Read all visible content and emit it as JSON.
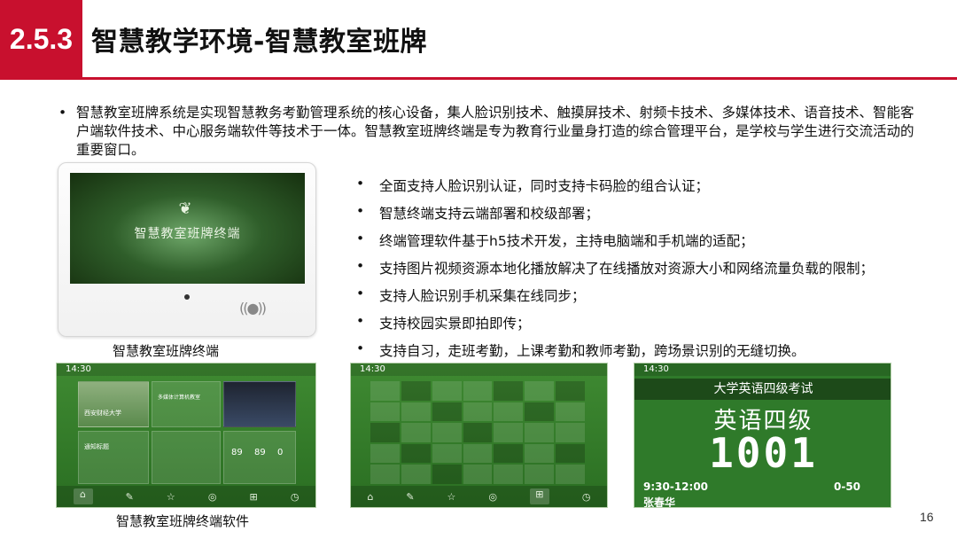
{
  "header": {
    "section_number": "2.5.3",
    "title": "智慧教学环境-智慧教室班牌",
    "accent_color": "#c8102e"
  },
  "intro": {
    "bullet": "•",
    "text": "智慧教室班牌系统是实现智慧教务考勤管理系统的核心设备，集人脸识别技术、触摸屏技术、射频卡技术、多媒体技术、语音技术、智能客户端软件技术、中心服务端软件等技术于一体。智慧教室班牌终端是专为教育行业量身打造的综合管理平台，是学校与学生进行交流活动的重要窗口。"
  },
  "device": {
    "screen_brand": "智慧教室班牌终端",
    "caption": "智慧教室班牌终端",
    "icons": [
      "leaf-icon",
      "nfc-icon"
    ]
  },
  "features": [
    "全面支持人脸识别认证，同时支持卡码脸的组合认证；",
    "智慧终端支持云端部署和校级部署；",
    "终端管理软件基于h5技术开发，主持电脑端和手机端的适配；",
    "支持图片视频资源本地化播放解决了在线播放对资源大小和网络流量负载的限制；",
    "支持人脸识别手机采集在线同步；",
    "支持校园实景即拍即传；",
    "支持自习，走班考勤，上课考勤和教师考勤，跨场景识别的无缝切换。"
  ],
  "screens": {
    "caption": "智慧教室班牌终端软件",
    "app1": {
      "time": "14:30",
      "photo_label": "西安财经大学",
      "course": "多媒体计算机教室",
      "notice": "通知标题",
      "numbers": [
        "89",
        "89",
        "0"
      ]
    },
    "app2": {
      "time": "14:30"
    },
    "app3": {
      "time": "14:30",
      "exam_title": "大学英语四级考试",
      "subject": "英语四级",
      "room": "1001",
      "time_range": "9:30-12:00",
      "seat_range": "0-50",
      "teacher": "张春华"
    }
  },
  "page_number": "16"
}
